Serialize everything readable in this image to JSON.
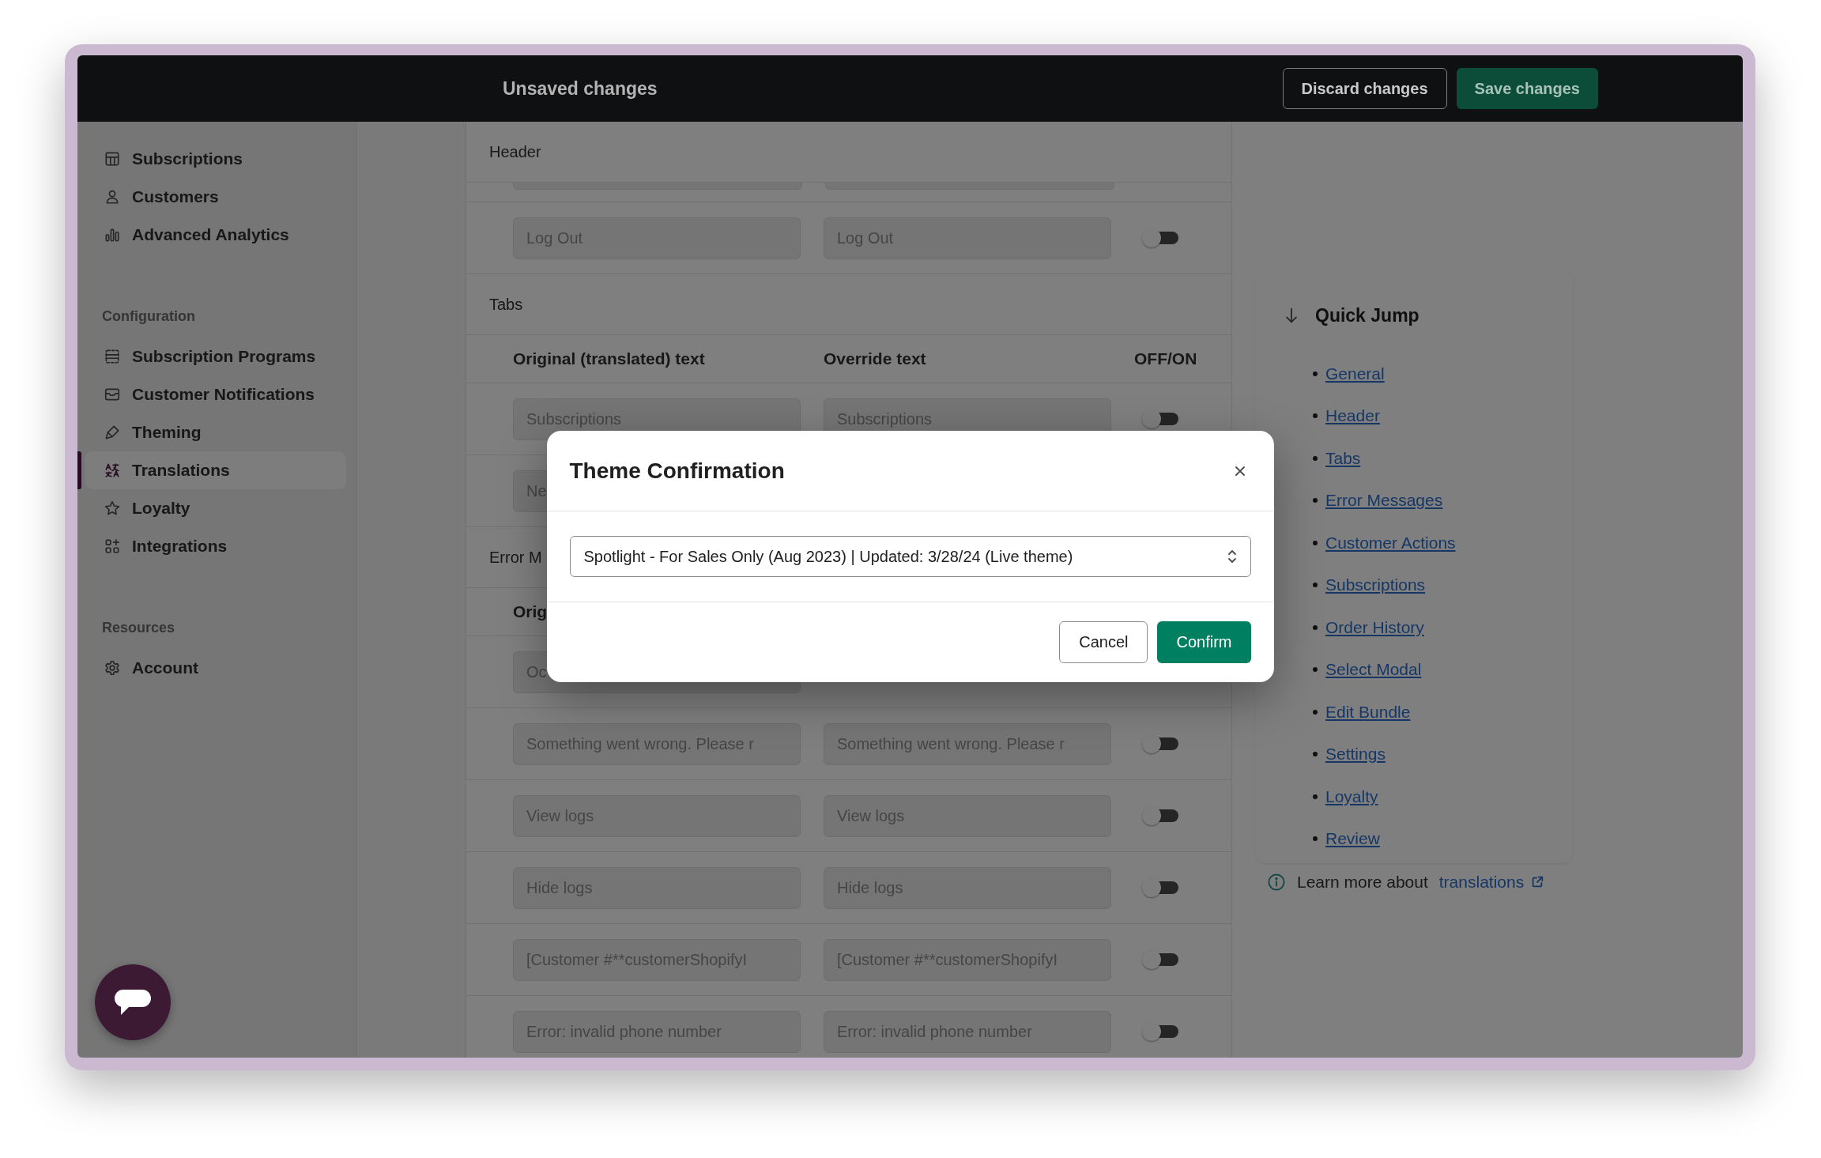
{
  "top_bar": {
    "title": "Unsaved changes",
    "buttons": [
      {
        "label": "Discard changes",
        "kind": "secondary"
      },
      {
        "label": "Save changes",
        "kind": "primary"
      }
    ]
  },
  "sidebar": {
    "sections": [
      {
        "items": [
          {
            "label": "Subscriptions",
            "selected": false
          },
          {
            "label": "Customers",
            "selected": false
          },
          {
            "label": "Advanced Analytics",
            "selected": false
          }
        ]
      },
      {
        "heading": "Configuration",
        "items": [
          {
            "label": "Subscription Programs",
            "selected": false
          },
          {
            "label": "Customer Notifications",
            "selected": false
          },
          {
            "label": "Theming",
            "selected": false
          },
          {
            "label": "Translations",
            "selected": true
          },
          {
            "label": "Loyalty",
            "selected": false
          },
          {
            "label": "Integrations",
            "selected": false
          }
        ]
      },
      {
        "heading": "Resources",
        "items": [
          {
            "label": "Account",
            "selected": false
          }
        ]
      }
    ]
  },
  "main": {
    "rows": [
      {
        "kind": "title",
        "text": "Header"
      },
      {
        "kind": "sliver"
      },
      {
        "kind": "row",
        "original": "Log Out",
        "override": "Log Out",
        "on": false
      },
      {
        "kind": "title",
        "text": "Tabs"
      },
      {
        "kind": "columns",
        "original": "Original (translated) text",
        "override": "Override text",
        "toggle": "OFF/ON"
      },
      {
        "kind": "row",
        "original": "Subscriptions",
        "override": "Subscriptions",
        "on": false
      },
      {
        "kind": "row",
        "original": "Ne"
      },
      {
        "kind": "title",
        "text": "Error M"
      },
      {
        "kind": "columns",
        "original": "Orig"
      },
      {
        "kind": "row",
        "original": "Oc"
      },
      {
        "kind": "row",
        "original": "Something went wrong. Please r",
        "override": "Something went wrong. Please r",
        "on": false
      },
      {
        "kind": "row",
        "original": "View logs",
        "override": "View logs",
        "on": false
      },
      {
        "kind": "row",
        "original": "Hide logs",
        "override": "Hide logs",
        "on": false
      },
      {
        "kind": "row",
        "original": "[Customer #**customerShopifyI",
        "override": "[Customer #**customerShopifyI",
        "on": false
      },
      {
        "kind": "row",
        "original": "Error: invalid phone number",
        "override": "Error: invalid phone number",
        "on": false
      }
    ]
  },
  "quick_jump": {
    "title": "Quick Jump",
    "links": [
      "General",
      "Header",
      "Tabs",
      "Error Messages",
      "Customer Actions",
      "Subscriptions",
      "Order History",
      "Select Modal",
      "Edit Bundle",
      "Settings",
      "Loyalty",
      "Review"
    ]
  },
  "learn_more": {
    "text": "Learn more about",
    "link": "translations"
  },
  "modal": {
    "title": "Theme Confirmation",
    "select": {
      "value": "Spotlight - For Sales Only (Aug 2023) | Updated: 3/28/24 (Live theme)"
    },
    "buttons": [
      {
        "label": "Cancel",
        "kind": "secondary"
      },
      {
        "label": "Confirm",
        "kind": "primary"
      }
    ]
  }
}
